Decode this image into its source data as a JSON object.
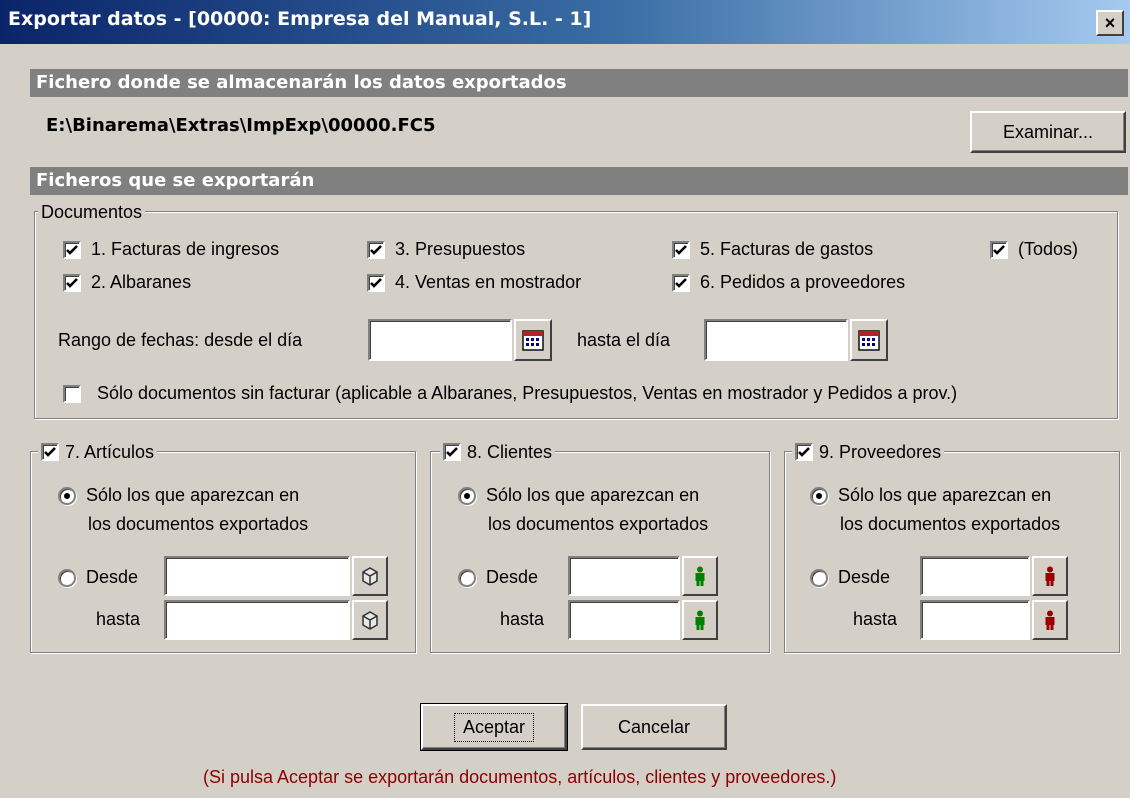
{
  "window": {
    "title": "Exportar datos - [00000: Empresa del Manual, S.L. - 1]",
    "close_glyph": "×"
  },
  "export_file": {
    "section_title": "Fichero donde se almacenarán los datos exportados",
    "path": "E:\\Binarema\\Extras\\ImpExp\\00000.FC5",
    "browse_label": "Examinar..."
  },
  "files_section": {
    "section_title": "Ficheros que se exportarán"
  },
  "documents": {
    "group_label": "Documentos",
    "options": [
      {
        "label": "1. Facturas de ingresos",
        "checked": true
      },
      {
        "label": "3. Presupuestos",
        "checked": true
      },
      {
        "label": "5. Facturas de gastos",
        "checked": true
      },
      {
        "label": "(Todos)",
        "checked": true
      },
      {
        "label": "2. Albaranes",
        "checked": true
      },
      {
        "label": "4. Ventas en mostrador",
        "checked": true
      },
      {
        "label": "6. Pedidos a proveedores",
        "checked": true
      }
    ],
    "date_from_label": "Rango de fechas: desde el día",
    "date_from_value": "",
    "date_to_label": "hasta el día",
    "date_to_value": "",
    "only_unbilled_label": "Sólo documentos sin facturar (aplicable a Albaranes, Presupuestos, Ventas en mostrador y Pedidos a prov.)",
    "only_unbilled_checked": false
  },
  "groups": [
    {
      "title": "7. Artículos",
      "checked": true,
      "radio_only_line1": "Sólo los que aparezcan en",
      "radio_only_line2": "los documentos exportados",
      "radio_only_selected": true,
      "from_label": "Desde",
      "to_label": "hasta",
      "from_value": "",
      "to_value": "",
      "lookup_icon": "box-icon",
      "lookup_color": "#808080"
    },
    {
      "title": "8. Clientes",
      "checked": true,
      "radio_only_line1": "Sólo los que aparezcan en",
      "radio_only_line2": "los documentos exportados",
      "radio_only_selected": true,
      "from_label": "Desde",
      "to_label": "hasta",
      "from_value": "",
      "to_value": "",
      "lookup_icon": "person-icon",
      "lookup_color": "#008000"
    },
    {
      "title": "9. Proveedores",
      "checked": true,
      "radio_only_line1": "Sólo los que aparezcan en",
      "radio_only_line2": "los documentos exportados",
      "radio_only_selected": true,
      "from_label": "Desde",
      "to_label": "hasta",
      "from_value": "",
      "to_value": "",
      "lookup_icon": "person-icon",
      "lookup_color": "#9b0000"
    }
  ],
  "buttons": {
    "accept_label": "Aceptar",
    "cancel_label": "Cancelar"
  },
  "footer_note": "(Si pulsa Aceptar se exportarán documentos, artículos, clientes y proveedores.)"
}
